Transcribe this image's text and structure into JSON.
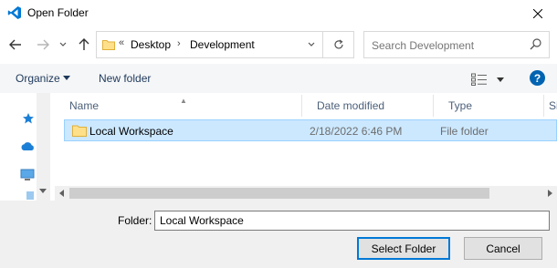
{
  "window": {
    "title": "Open Folder",
    "app_icon": "vscode-icon",
    "close_icon": "close-icon"
  },
  "nav": {
    "back_icon": "back-arrow-icon",
    "forward_icon": "forward-arrow-icon",
    "recent_icon": "chevron-down-icon",
    "up_icon": "up-arrow-icon"
  },
  "address": {
    "overflow": "«",
    "crumbs": [
      "Desktop",
      "Development"
    ],
    "refresh_icon": "refresh-icon"
  },
  "search": {
    "placeholder": "Search Development"
  },
  "toolbar": {
    "organize_label": "Organize",
    "new_folder_label": "New folder",
    "help_label": "?"
  },
  "columns": [
    "Name",
    "Date modified",
    "Type",
    "Si"
  ],
  "files": [
    {
      "name": "Local Workspace",
      "date": "2/18/2022 6:46 PM",
      "type": "File folder",
      "selected": true
    }
  ],
  "footer": {
    "folder_label": "Folder:",
    "folder_value": "Local Workspace",
    "select_label": "Select Folder",
    "cancel_label": "Cancel"
  },
  "colors": {
    "accent": "#0078d7",
    "selection_bg": "#cce8ff",
    "selection_border": "#99d1ff"
  }
}
